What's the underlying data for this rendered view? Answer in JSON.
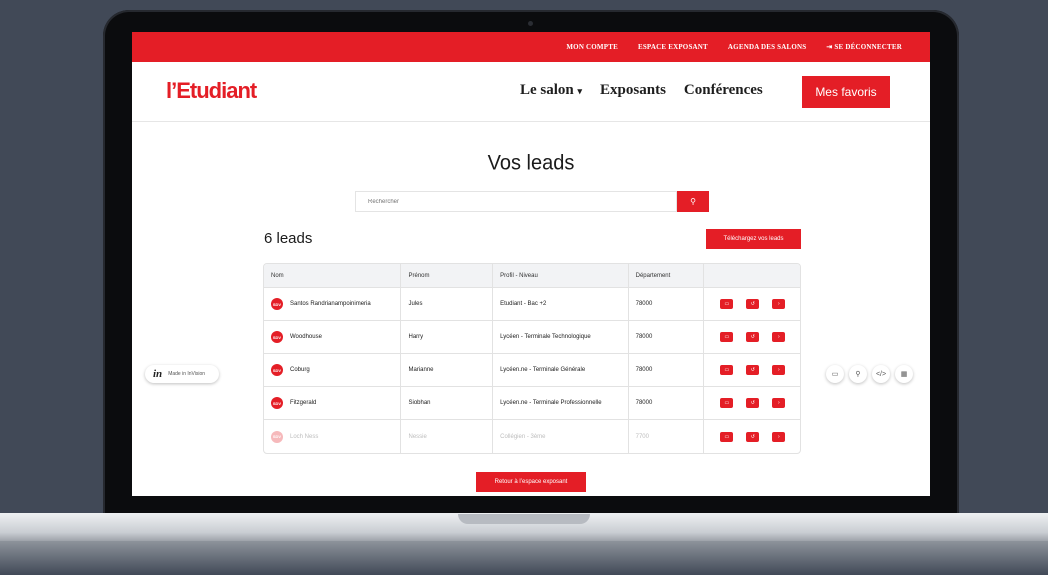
{
  "topbar": {
    "links": [
      "MON COMPTE",
      "ESPACE EXPOSANT",
      "AGENDA DES SALONS",
      "SE DÉCONNECTER"
    ],
    "logout_icon": "logout-icon"
  },
  "header": {
    "logo": "l’Etudiant",
    "nav": [
      "Le salon",
      "Exposants",
      "Conférences"
    ],
    "nav_dropdown_icon": "chevron-down-icon",
    "favorites_button": "Mes favoris"
  },
  "main": {
    "title": "Vos leads",
    "search": {
      "placeholder": "Rechercher",
      "button_icon": "search-icon"
    },
    "leads_count": "6 leads",
    "download_button": "Téléchargez vos leads",
    "table": {
      "headers": [
        "Nom",
        "Prénom",
        "Profil - Niveau",
        "Département",
        ""
      ],
      "rows": [
        {
          "badge": "SDV",
          "nom": "Santos Randrianampoinimeria",
          "prenom": "Jules",
          "profil": "Etudiant - Bac +2",
          "departement": "78000"
        },
        {
          "badge": "SDV",
          "nom": "Woodhouse",
          "prenom": "Harry",
          "profil": "Lycéen  - Terminale Technologique",
          "departement": "78000"
        },
        {
          "badge": "SDV",
          "nom": "Coburg",
          "prenom": "Marianne",
          "profil": "Lycéen.ne - Terminale Générale",
          "departement": "78000"
        },
        {
          "badge": "SDV",
          "nom": "Fitzgerald",
          "prenom": "Siobhan",
          "profil": "Lycéen.ne - Terminale Professionnelle",
          "departement": "78000"
        },
        {
          "badge": "SDV",
          "nom": "Loch Ness",
          "prenom": "Nessie",
          "profil": "Collégien - 3ème",
          "departement": "7700"
        }
      ],
      "row_actions": [
        "comment-icon",
        "history-icon",
        "chevron-right-icon"
      ]
    },
    "back_button": "Retour à l’espace exposant"
  },
  "invision": {
    "badge_logo": "in",
    "badge_text": "Made in InVision",
    "tools": [
      "comment-icon",
      "search-icon",
      "code-icon",
      "grid-icon"
    ]
  },
  "colors": {
    "brand": "#e41e26",
    "background": "#414957"
  }
}
